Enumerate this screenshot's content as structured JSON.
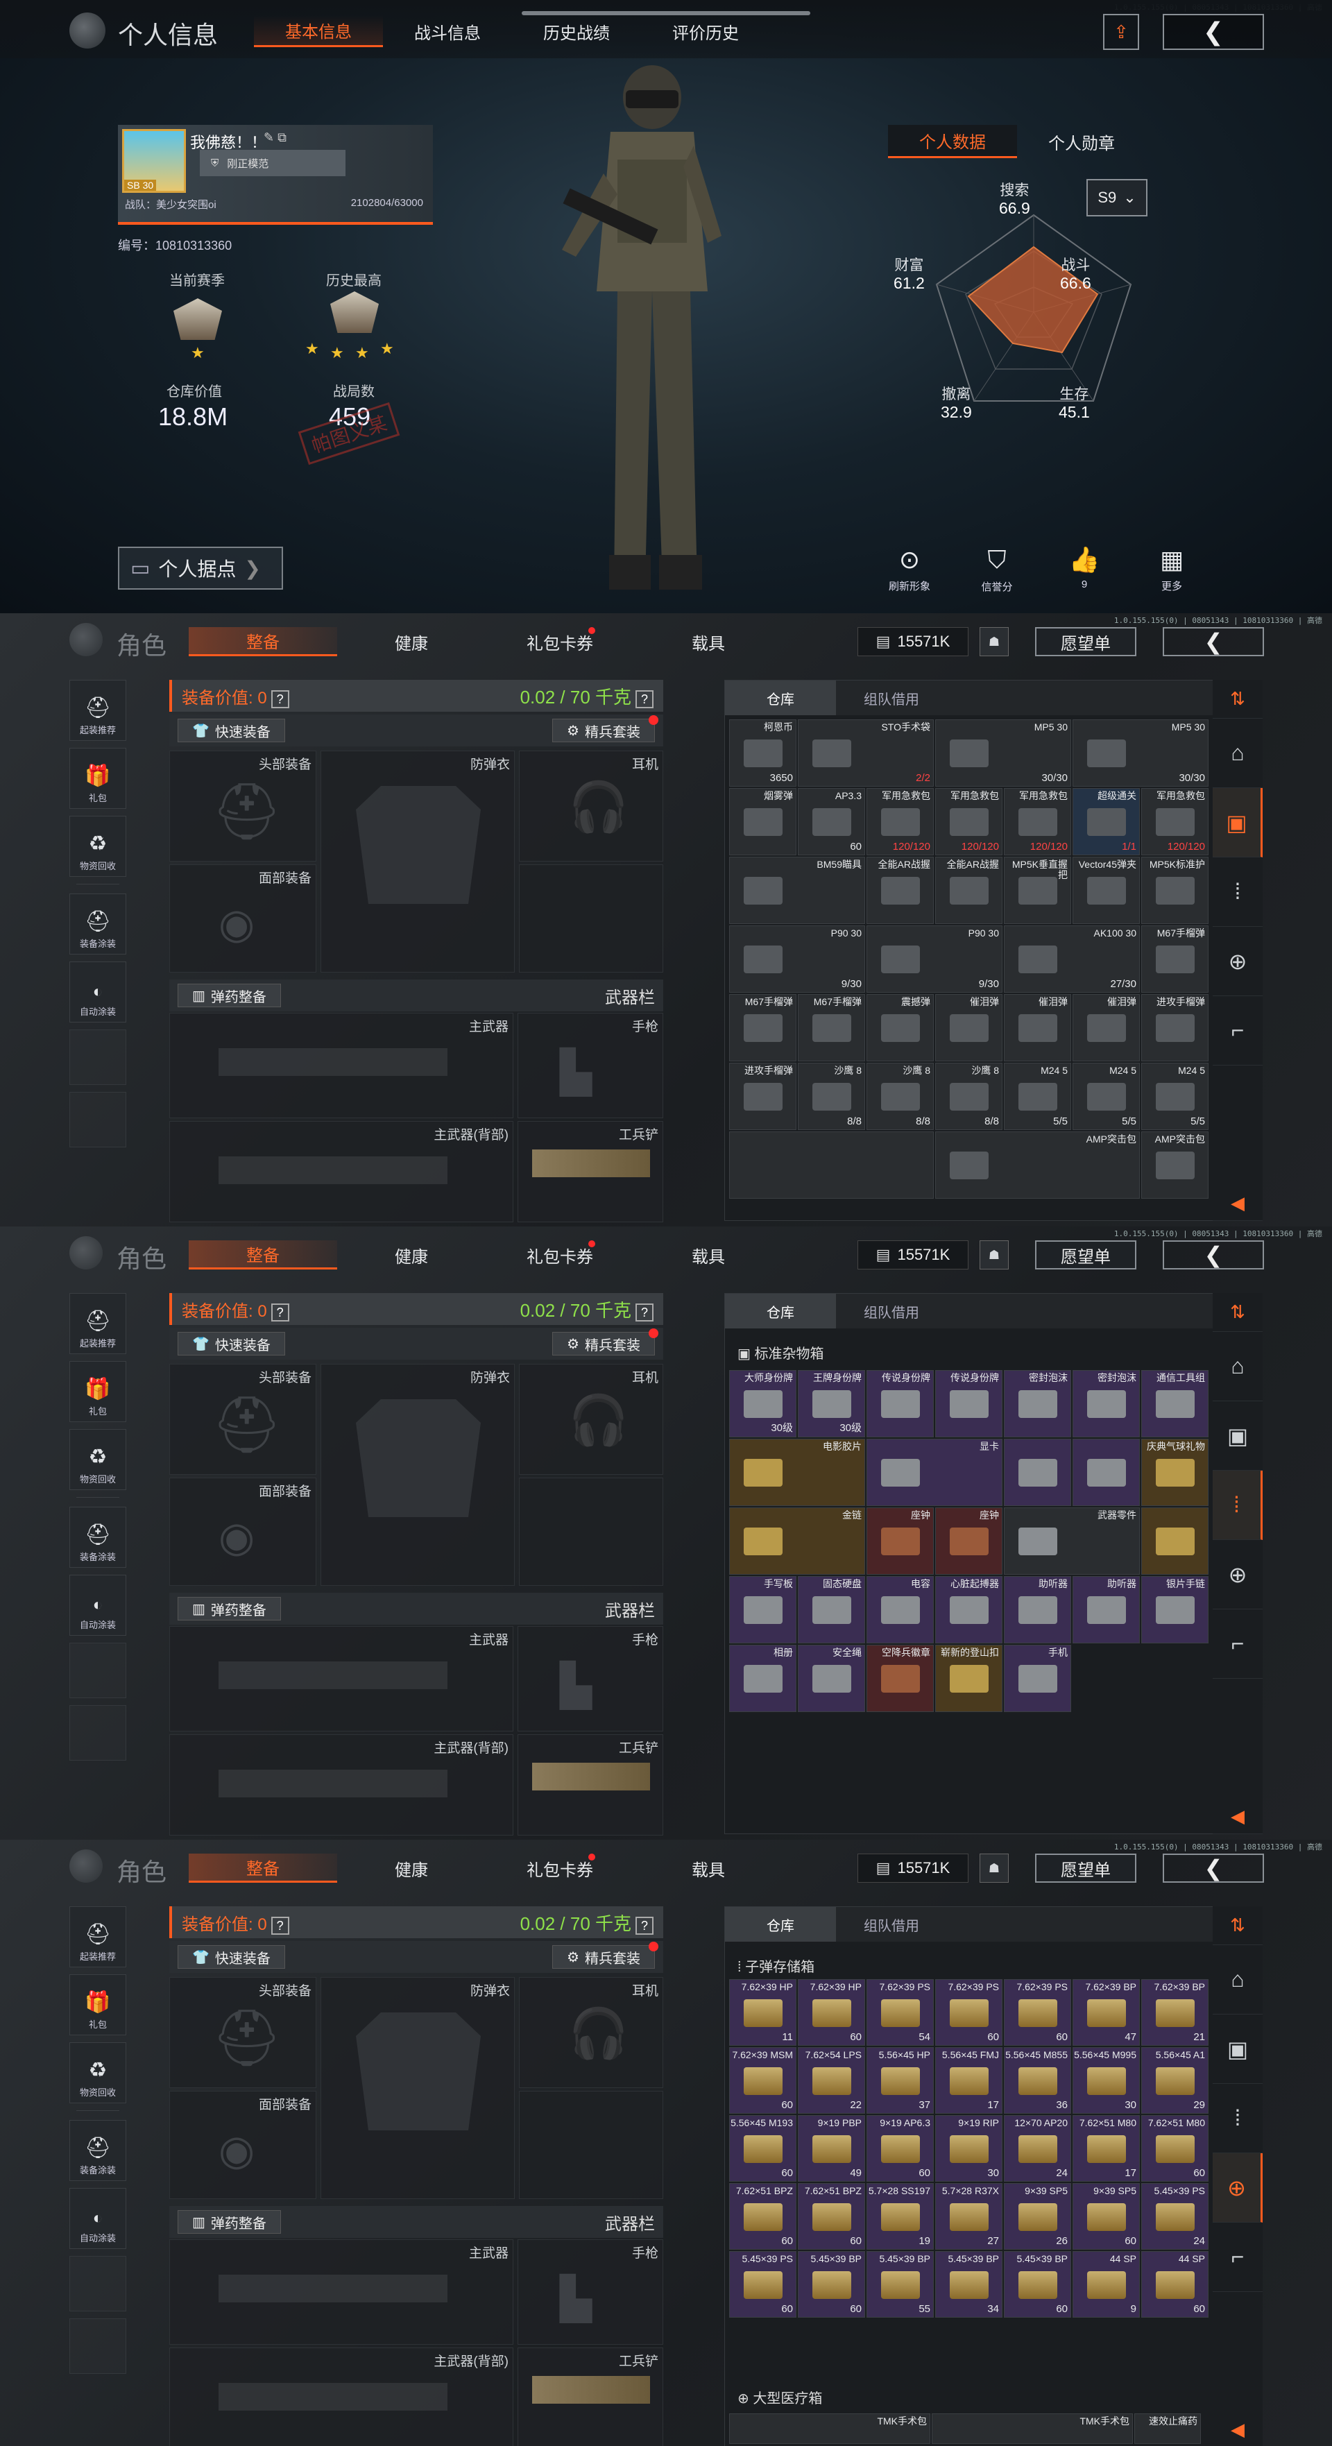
{
  "version": "1.0.155.155(0) | 08051343 | 10810313360 | 高德",
  "screen1": {
    "title": "个人信息",
    "tabs": [
      "基本信息",
      "战斗信息",
      "历史战绩",
      "评价历史"
    ],
    "active_tab": 0,
    "player": {
      "name": "我佛慈！！",
      "avatar_level": "SB 30",
      "rank": "刚正模范",
      "team": "战队：美少女突围oi",
      "exp": "2102804/63000",
      "uid": "编号：10810313360"
    },
    "season_current_label": "当前赛季",
    "season_best_label": "历史最高",
    "warehouse_value_label": "仓库价值",
    "warehouse_value": "18.8M",
    "battles_label": "战局数",
    "battles": "459",
    "stamp": "帕图义某",
    "base_button": "个人据点",
    "right_tabs": [
      "个人数据",
      "个人勋章"
    ],
    "season_select": "S9",
    "radar": [
      {
        "label": "搜索",
        "value": "66.9"
      },
      {
        "label": "战斗",
        "value": "66.6"
      },
      {
        "label": "生存",
        "value": "45.1"
      },
      {
        "label": "撤离",
        "value": "32.9"
      },
      {
        "label": "财富",
        "value": "61.2"
      }
    ],
    "actions": [
      {
        "icon": "refresh-look-icon",
        "label": "刷新形象"
      },
      {
        "icon": "credit-icon",
        "label": "信誉分"
      },
      {
        "icon": "thumbs-up-icon",
        "label": "9"
      },
      {
        "icon": "more-icon",
        "label": "更多"
      }
    ]
  },
  "inventory": {
    "title": "角色",
    "tabs": [
      "整备",
      "健康",
      "礼包卡券",
      "载具"
    ],
    "money": "15571K",
    "wishlist": "愿望单",
    "left_buttons": [
      "起装推荐",
      "礼包",
      "物资回收",
      "装备涂装",
      "自动涂装"
    ],
    "equip_value_label": "装备价值: 0",
    "weight": "0.02 / 70 千克",
    "quick_equip": "快速装备",
    "elite_set": "精兵套装",
    "ammo_equip": "弹药整备",
    "weapons_label": "武器栏",
    "slots": {
      "head": "头部装备",
      "armor": "防弹衣",
      "ear": "耳机",
      "face": "面部装备",
      "primary": "主武器",
      "pistol": "手枪",
      "primary_back": "主武器(背部)",
      "shovel": "工兵铲"
    },
    "warehouse_tabs": [
      "仓库",
      "组队借用"
    ]
  },
  "screen2_items": [
    {
      "name": "柯恩币",
      "count": "3650",
      "tint": ""
    },
    {
      "name": "STO手术袋",
      "count": "2/2",
      "tint": "",
      "red": true,
      "span": 2
    },
    {
      "name": "MP5 30",
      "count": "30/30",
      "tint": "",
      "span": 2
    },
    {
      "name": "MP5 30",
      "count": "30/30",
      "tint": "",
      "span": 2
    },
    {
      "name": "烟雾弹",
      "count": "",
      "tint": ""
    },
    {
      "name": "AP3.3",
      "count": "60",
      "tint": ""
    },
    {
      "name": "军用急救包",
      "count": "120/120",
      "tint": "",
      "red": true
    },
    {
      "name": "军用急救包",
      "count": "120/120",
      "tint": "",
      "red": true
    },
    {
      "name": "军用急救包",
      "count": "120/120",
      "tint": "",
      "red": true
    },
    {
      "name": "超级通关",
      "count": "1/1",
      "tint": "blue",
      "red": true
    },
    {
      "name": "军用急救包",
      "count": "120/120",
      "tint": "",
      "red": true
    },
    {
      "name": "BM59瞄具",
      "count": "",
      "tint": "",
      "span": 2
    },
    {
      "name": "全能AR战握",
      "count": "",
      "tint": ""
    },
    {
      "name": "全能AR战握",
      "count": "",
      "tint": ""
    },
    {
      "name": "MP5K垂直握把",
      "count": "",
      "tint": ""
    },
    {
      "name": "Vector45弹夹",
      "count": "",
      "tint": ""
    },
    {
      "name": "MP5K标准护",
      "count": "",
      "tint": ""
    },
    {
      "name": "P90 30",
      "count": "9/30",
      "tint": "",
      "span": 2
    },
    {
      "name": "P90 30",
      "count": "9/30",
      "tint": "",
      "span": 2
    },
    {
      "name": "AK100 30",
      "count": "27/30",
      "tint": "",
      "span": 2
    },
    {
      "name": "M67手榴弹",
      "count": "",
      "tint": ""
    },
    {
      "name": "M67手榴弹",
      "count": "",
      "tint": ""
    },
    {
      "name": "M67手榴弹",
      "count": "",
      "tint": ""
    },
    {
      "name": "震撼弹",
      "count": "",
      "tint": ""
    },
    {
      "name": "催泪弹",
      "count": "",
      "tint": ""
    },
    {
      "name": "催泪弹",
      "count": "",
      "tint": ""
    },
    {
      "name": "催泪弹",
      "count": "",
      "tint": ""
    },
    {
      "name": "进攻手榴弹",
      "count": "",
      "tint": ""
    },
    {
      "name": "进攻手榴弹",
      "count": "",
      "tint": ""
    },
    {
      "name": "沙鹰 8",
      "count": "8/8",
      "tint": ""
    },
    {
      "name": "沙鹰 8",
      "count": "8/8",
      "tint": ""
    },
    {
      "name": "沙鹰 8",
      "count": "8/8",
      "tint": ""
    },
    {
      "name": "M24 5",
      "count": "5/5",
      "tint": ""
    },
    {
      "name": "M24 5",
      "count": "5/5",
      "tint": ""
    },
    {
      "name": "M24 5",
      "count": "5/5",
      "tint": ""
    },
    {
      "name": "",
      "count": "",
      "tint": "",
      "span": 3
    },
    {
      "name": "AMP突击包",
      "count": "",
      "tint": "",
      "span": 3
    },
    {
      "name": "AMP突击包",
      "count": "",
      "tint": ""
    }
  ],
  "screen3": {
    "section": "标准杂物箱",
    "items": [
      {
        "name": "大师身份牌",
        "count": "30级",
        "tint": "purple"
      },
      {
        "name": "王牌身份牌",
        "count": "30级",
        "tint": "purple"
      },
      {
        "name": "传说身份牌",
        "count": "",
        "tint": "purple"
      },
      {
        "name": "传说身份牌",
        "count": "",
        "tint": "purple"
      },
      {
        "name": "密封泡沫",
        "count": "",
        "tint": "purple"
      },
      {
        "name": "密封泡沫",
        "count": "",
        "tint": "purple"
      },
      {
        "name": "通信工具组",
        "count": "",
        "tint": "purple"
      },
      {
        "name": "电影胶片",
        "count": "",
        "tint": "gold",
        "span": 2
      },
      {
        "name": "显卡",
        "count": "",
        "tint": "purple",
        "span": 2
      },
      {
        "name": "",
        "count": "",
        "tint": "purple"
      },
      {
        "name": "",
        "count": "",
        "tint": "purple"
      },
      {
        "name": "庆典气球礼物",
        "count": "",
        "tint": "gold"
      },
      {
        "name": "金链",
        "count": "",
        "tint": "gold",
        "span": 2
      },
      {
        "name": "座钟",
        "count": "",
        "tint": "red"
      },
      {
        "name": "座钟",
        "count": "",
        "tint": "red"
      },
      {
        "name": "武器零件",
        "count": "",
        "tint": "",
        "span": 2
      },
      {
        "name": "",
        "count": "",
        "tint": "gold"
      },
      {
        "name": "手写板",
        "count": "",
        "tint": "purple"
      },
      {
        "name": "固态硬盘",
        "count": "",
        "tint": "purple"
      },
      {
        "name": "电容",
        "count": "",
        "tint": "purple"
      },
      {
        "name": "心脏起搏器",
        "count": "",
        "tint": "purple"
      },
      {
        "name": "助听器",
        "count": "",
        "tint": "purple"
      },
      {
        "name": "助听器",
        "count": "",
        "tint": "purple"
      },
      {
        "name": "银片手链",
        "count": "",
        "tint": "purple"
      },
      {
        "name": "相册",
        "count": "",
        "tint": "purple"
      },
      {
        "name": "安全绳",
        "count": "",
        "tint": "purple"
      },
      {
        "name": "空降兵徽章",
        "count": "",
        "tint": "red"
      },
      {
        "name": "崭新的登山扣",
        "count": "",
        "tint": "gold"
      },
      {
        "name": "手机",
        "count": "",
        "tint": "purple"
      }
    ]
  },
  "screen4": {
    "section": "子弹存储箱",
    "section2": "大型医疗箱",
    "ammo": [
      {
        "name": "7.62×39 HP",
        "count": "11"
      },
      {
        "name": "7.62×39 HP",
        "count": "60"
      },
      {
        "name": "7.62×39 PS",
        "count": "54"
      },
      {
        "name": "7.62×39 PS",
        "count": "60"
      },
      {
        "name": "7.62×39 PS",
        "count": "60"
      },
      {
        "name": "7.62×39 BP",
        "count": "47"
      },
      {
        "name": "7.62×39 BP",
        "count": "21"
      },
      {
        "name": "7.62×39 MSM",
        "count": "60"
      },
      {
        "name": "7.62×54 LPS",
        "count": "22"
      },
      {
        "name": "5.56×45 HP",
        "count": "37"
      },
      {
        "name": "5.56×45 FMJ",
        "count": "17"
      },
      {
        "name": "5.56×45 M855",
        "count": "36"
      },
      {
        "name": "5.56×45 M995",
        "count": "30"
      },
      {
        "name": "5.56×45 A1",
        "count": "29"
      },
      {
        "name": "5.56×45 M193",
        "count": "60"
      },
      {
        "name": "9×19 PBP",
        "count": "49"
      },
      {
        "name": "9×19 AP6.3",
        "count": "60"
      },
      {
        "name": "9×19 RIP",
        "count": "30"
      },
      {
        "name": "12×70 AP20",
        "count": "24"
      },
      {
        "name": "7.62×51 M80",
        "count": "17"
      },
      {
        "name": "7.62×51 M80",
        "count": "60"
      },
      {
        "name": "7.62×51 BPZ",
        "count": "60"
      },
      {
        "name": "7.62×51 BPZ",
        "count": "60"
      },
      {
        "name": "5.7×28 SS197",
        "count": "19"
      },
      {
        "name": "5.7×28 R37X",
        "count": "27"
      },
      {
        "name": "9×39 SP5",
        "count": "26"
      },
      {
        "name": "9×39 SP5",
        "count": "60"
      },
      {
        "name": "5.45×39 PS",
        "count": "24"
      },
      {
        "name": "5.45×39 PS",
        "count": "60"
      },
      {
        "name": "5.45×39 BP",
        "count": "60"
      },
      {
        "name": "5.45×39 BP",
        "count": "55"
      },
      {
        "name": "5.45×39 BP",
        "count": "34"
      },
      {
        "name": "5.45×39 BP",
        "count": "60"
      },
      {
        "name": "44 SP",
        "count": "9"
      },
      {
        "name": "44 SP",
        "count": "60"
      }
    ],
    "med": [
      {
        "name": "TMK手术包"
      },
      {
        "name": "TMK手术包"
      },
      {
        "name": "速效止痛药"
      }
    ]
  }
}
